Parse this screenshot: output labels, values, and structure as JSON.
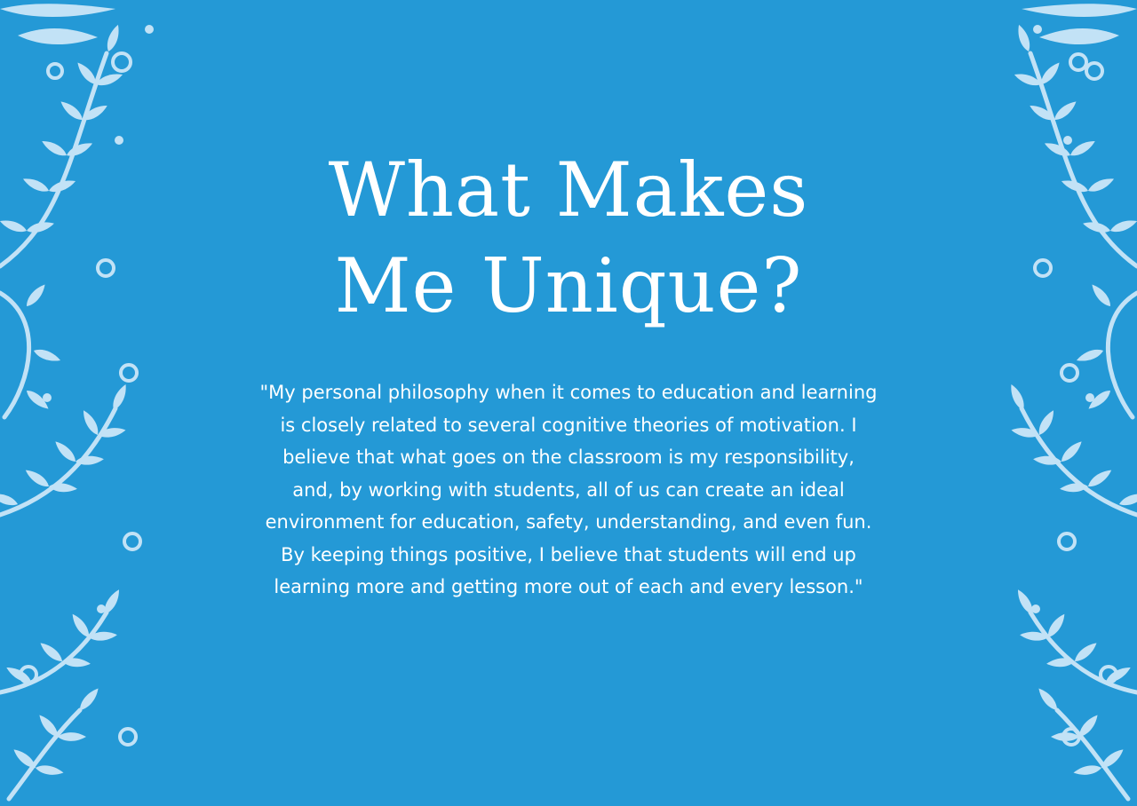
{
  "colors": {
    "background": "#2499d6",
    "ornament": "#c2e2f6",
    "text": "#ffffff"
  },
  "icons": {
    "left_border": "leafy-vine-border-icon",
    "right_border": "leafy-vine-border-icon"
  },
  "heading": {
    "line1": "What Makes",
    "line2": "Me Unique?"
  },
  "quote": {
    "text": "\"My personal philosophy when it comes to education and learning is closely related to several cognitive theories of motivation. I believe that what goes on the classroom is my responsibility, and, by working with students, all of us can create an ideal environment for education, safety, understanding, and even fun. By keeping things positive, I believe that students will end up learning more and getting more out of each and every lesson.\""
  }
}
